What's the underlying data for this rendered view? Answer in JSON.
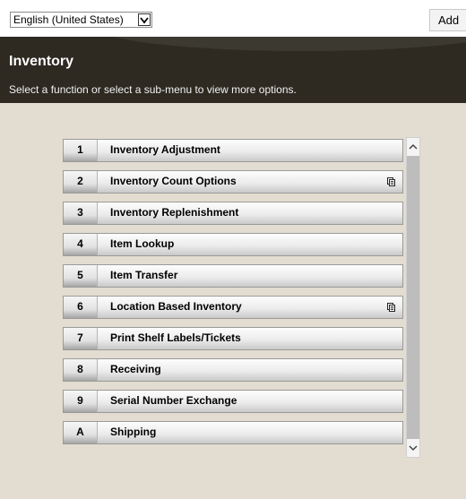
{
  "language_select": {
    "value": "English (United States)"
  },
  "add_button": {
    "label": "Add"
  },
  "header": {
    "title": "Inventory",
    "subtitle": "Select a function or select a sub-menu to view more options."
  },
  "menu": {
    "items": [
      {
        "key": "1",
        "label": "Inventory Adjustment",
        "submenu": false
      },
      {
        "key": "2",
        "label": "Inventory Count Options",
        "submenu": true
      },
      {
        "key": "3",
        "label": "Inventory Replenishment",
        "submenu": false
      },
      {
        "key": "4",
        "label": "Item Lookup",
        "submenu": false
      },
      {
        "key": "5",
        "label": "Item Transfer",
        "submenu": false
      },
      {
        "key": "6",
        "label": "Location Based Inventory",
        "submenu": true
      },
      {
        "key": "7",
        "label": "Print Shelf Labels/Tickets",
        "submenu": false
      },
      {
        "key": "8",
        "label": "Receiving",
        "submenu": false
      },
      {
        "key": "9",
        "label": "Serial Number Exchange",
        "submenu": false
      },
      {
        "key": "A",
        "label": "Shipping",
        "submenu": false
      }
    ]
  },
  "icons": {
    "submenu": "document-stack-icon",
    "dropdown": "chevron-down-icon",
    "scroll_up": "chevron-up-icon",
    "scroll_down": "chevron-down-icon"
  },
  "colors": {
    "header_bg": "#2e2a22",
    "content_bg": "#e2ddd0",
    "scrollbar_track": "#bdbdbd"
  }
}
